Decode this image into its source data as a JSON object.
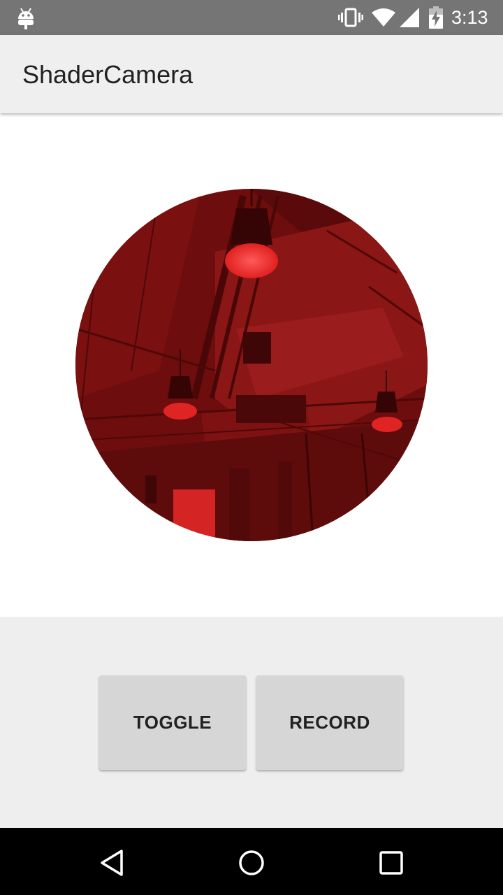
{
  "status_bar": {
    "time": "3:13",
    "icons": [
      "android-icon",
      "vibrate-icon",
      "wifi-icon",
      "signal-icon",
      "battery-charging-icon"
    ]
  },
  "app_bar": {
    "title": "ShaderCamera"
  },
  "camera_preview": {
    "shape": "circle",
    "tint_color": "#b01414"
  },
  "controls": {
    "toggle_label": "TOGGLE",
    "record_label": "RECORD"
  },
  "nav_bar": {
    "icons": [
      "back-icon",
      "home-icon",
      "recents-icon"
    ]
  },
  "colors": {
    "status_bar": "#757575",
    "app_bar": "#efefef",
    "controls_bg": "#eeeeee",
    "button_bg": "#d6d6d6",
    "nav_bar": "#000000"
  }
}
